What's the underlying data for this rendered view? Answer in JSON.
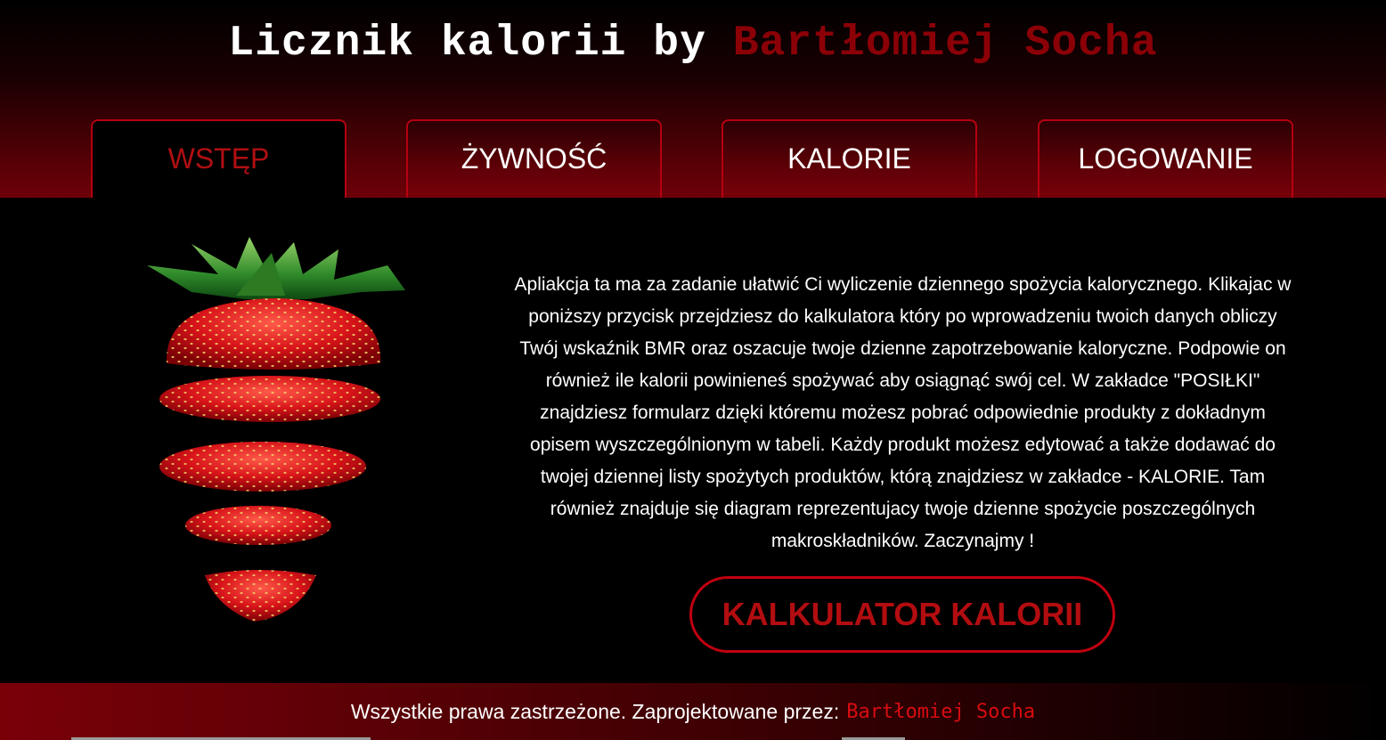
{
  "header": {
    "title_prefix": "Licznik kalorii by",
    "title_author": "Bartłomiej Socha"
  },
  "nav": {
    "active_tab": "WSTĘP",
    "tabs": [
      {
        "label": "WSTĘP"
      },
      {
        "label": "ŻYWNOŚĆ"
      },
      {
        "label": "KALORIE"
      },
      {
        "label": "LOGOWANIE"
      }
    ]
  },
  "main": {
    "intro_text": "Apliakcja ta ma za zadanie ułatwić Ci wyliczenie dziennego spożycia kalorycznego. Klikajac w poniższy przycisk przejdziesz do kalkulatora który po wprowadzeniu twoich danych obliczy Twój wskaźnik BMR oraz oszacuje twoje dzienne zapotrzebowanie kaloryczne. Podpowie on również ile kalorii powinieneś spożywać aby osiągnąć swój cel. W zakładce \"POSIŁKI\" znajdziesz formularz dzięki któremu możesz pobrać odpowiednie produkty z dokładnym opisem wyszczególnionym w tabeli. Każdy produkt możesz edytować a także dodawać do twojej dziennej listy spożytych produktów, którą znajdziesz w zakładce - KALORIE. Tam również znajduje się diagram reprezentujacy twoje dzienne spożycie poszczególnych makroskładników. Zaczynajmy !",
    "calc_button_label": "KALKULATOR KALORII"
  },
  "footer": {
    "text": "Wszystkie prawa zastrzeżone. Zaprojektowane przez:",
    "author": "Bartłomiej Socha"
  },
  "colors": {
    "accent_red": "#b20d10",
    "author_dark_red": "#8b0007",
    "background": "#000000"
  }
}
